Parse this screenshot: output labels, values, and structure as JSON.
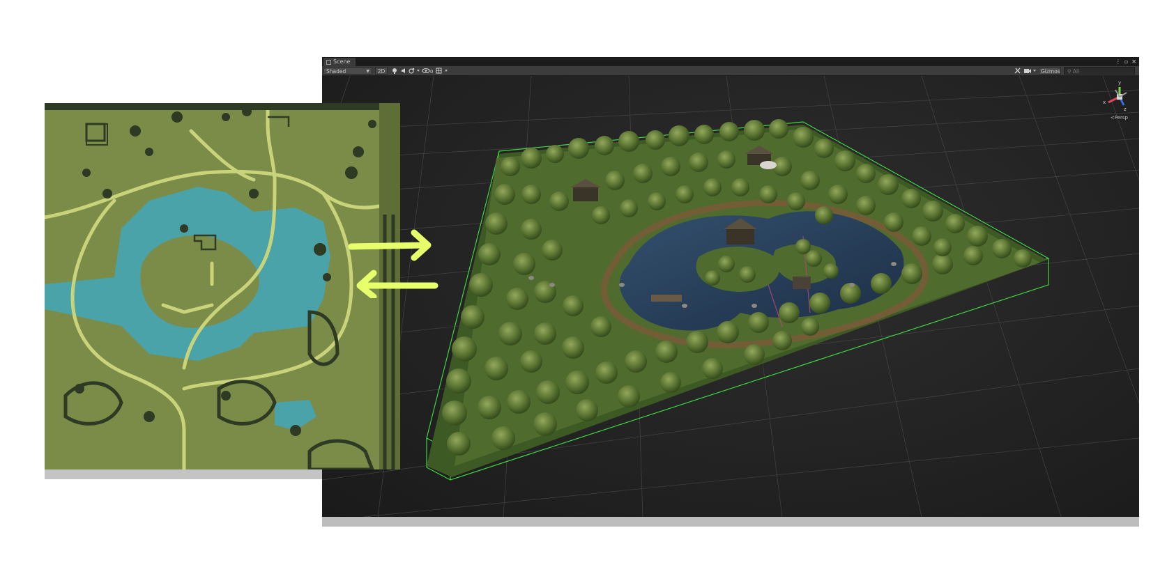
{
  "scene_window": {
    "tab_label": "Scene",
    "window_controls": [
      "⋮",
      "▫",
      "✕"
    ],
    "toolbar": {
      "draw_mode": "Shaded",
      "toggle_2d": "2D",
      "gizmos_label": "Gizmos",
      "search_placeholder": "All"
    },
    "view_label": "<Persp",
    "axis_labels": {
      "x": "x",
      "y": "y",
      "z": "z"
    }
  },
  "colors": {
    "grass": "#7a8c48",
    "path": "#c9d37a",
    "water": "#4aa3a8",
    "obstacle": "#2e3a24",
    "arrow": "#e6ff6a",
    "bounds": "#3ed63e",
    "toolbar": "#3c3c3c"
  },
  "icons": [
    "scene-tab-icon",
    "lighting-icon",
    "audio-icon",
    "effects-icon",
    "visibility-icon",
    "grid-icon",
    "tools-icon",
    "camera-icon",
    "search-icon"
  ]
}
